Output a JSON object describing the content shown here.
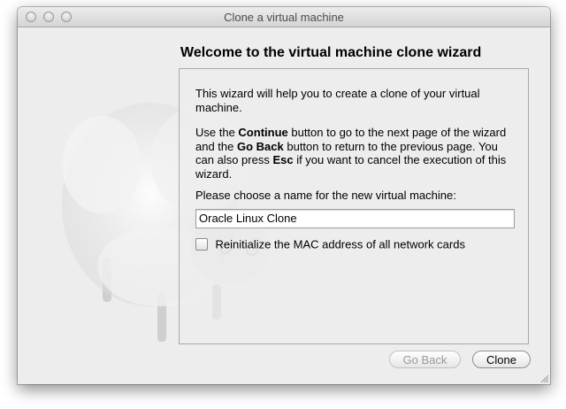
{
  "window": {
    "title": "Clone a virtual machine"
  },
  "wizard": {
    "heading": "Welcome to the virtual machine clone wizard",
    "intro": "This wizard will help you to create a clone of your virtual machine.",
    "instructions_parts": [
      "Use the ",
      "Continue",
      " button to go to the next page of the wizard and the ",
      "Go Back",
      " button to return to the previous page. You can also press ",
      "Esc",
      " if you want to cancel the execution of this wizard."
    ],
    "name_prompt": "Please choose a name for the new virtual machine:",
    "name_value": "Oracle Linux Clone",
    "reinit_mac_label": "Reinitialize the MAC address of all network cards",
    "reinit_mac_checked": false
  },
  "buttons": {
    "go_back": "Go Back",
    "clone": "Clone"
  }
}
